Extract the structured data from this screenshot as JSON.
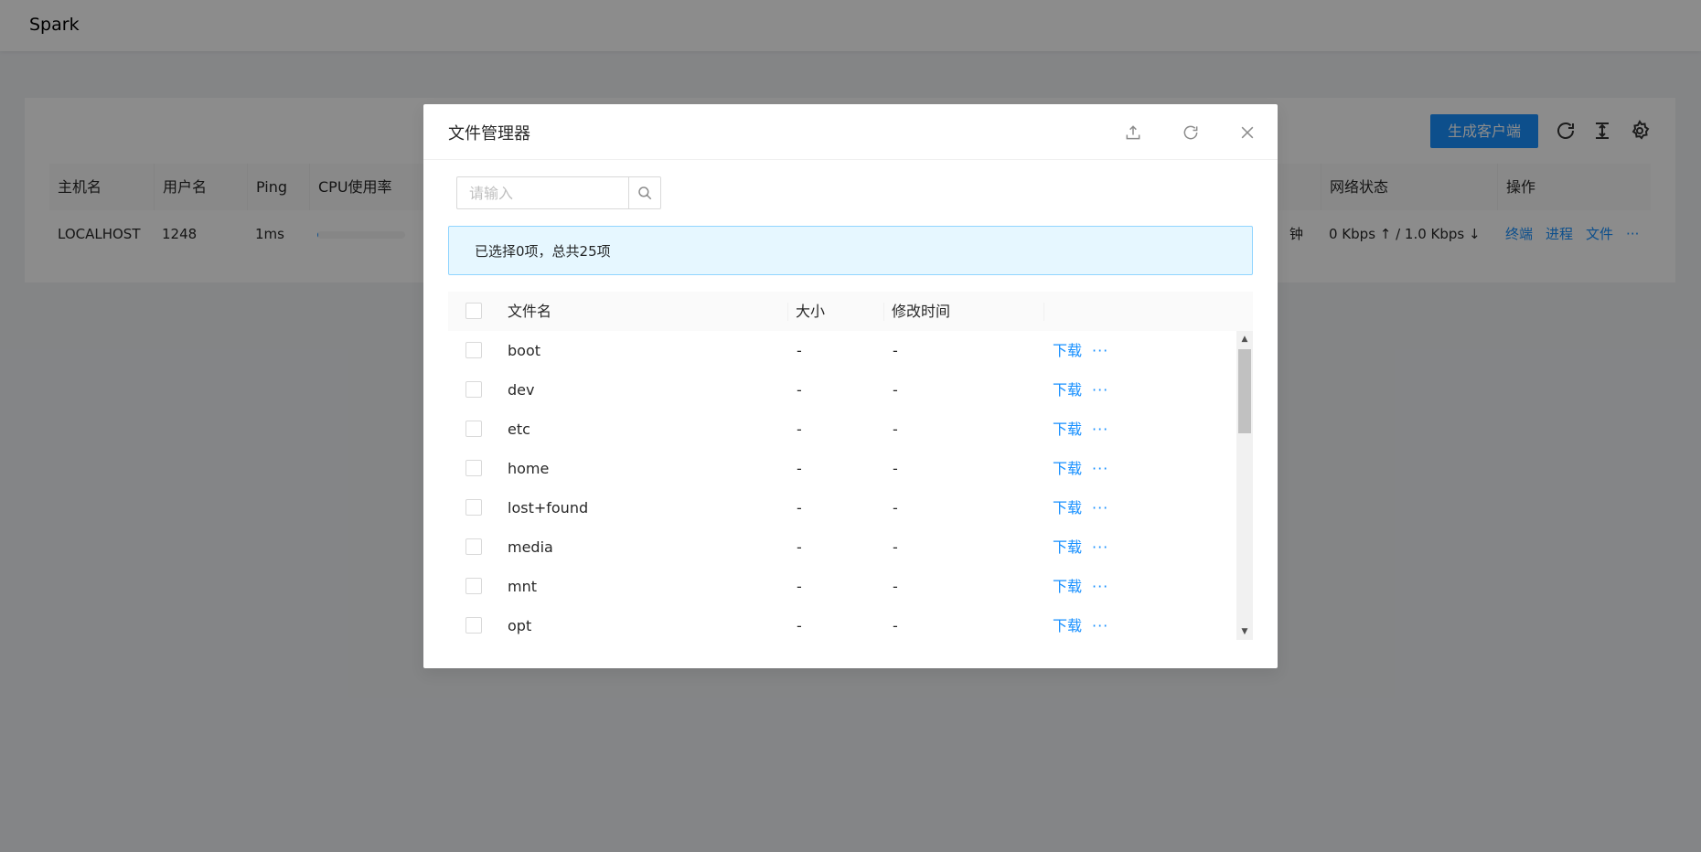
{
  "app": {
    "title": "Spark"
  },
  "toolbar": {
    "generate_client": "生成客户端"
  },
  "bg_table": {
    "headers": {
      "hostname": "主机名",
      "username": "用户名",
      "ping": "Ping",
      "cpu": "CPU使用率",
      "network": "网络状态",
      "actions": "操作"
    },
    "row": {
      "hostname": "LOCALHOST",
      "username": "1248",
      "ping": "1ms",
      "uptime_tail": "钟",
      "network": "0 Kbps ↑ / 1.0 Kbps ↓",
      "actions": [
        "终端",
        "进程",
        "文件"
      ],
      "more": "···"
    },
    "cpu_usage_fraction": 0.01
  },
  "modal": {
    "title": "文件管理器",
    "search": {
      "placeholder": "请输入",
      "value": ""
    },
    "alert": "已选择0项，总共25项",
    "columns": {
      "name": "文件名",
      "size": "大小",
      "mtime": "修改时间"
    },
    "files": [
      {
        "name": "boot",
        "size": "-",
        "mtime": "-",
        "action": "下载",
        "more": "···"
      },
      {
        "name": "dev",
        "size": "-",
        "mtime": "-",
        "action": "下载",
        "more": "···"
      },
      {
        "name": "etc",
        "size": "-",
        "mtime": "-",
        "action": "下载",
        "more": "···"
      },
      {
        "name": "home",
        "size": "-",
        "mtime": "-",
        "action": "下载",
        "more": "···"
      },
      {
        "name": "lost+found",
        "size": "-",
        "mtime": "-",
        "action": "下载",
        "more": "···"
      },
      {
        "name": "media",
        "size": "-",
        "mtime": "-",
        "action": "下载",
        "more": "···"
      },
      {
        "name": "mnt",
        "size": "-",
        "mtime": "-",
        "action": "下载",
        "more": "···"
      },
      {
        "name": "opt",
        "size": "-",
        "mtime": "-",
        "action": "下载",
        "more": "···"
      }
    ]
  },
  "colors": {
    "primary": "#1890ff",
    "alert_bg": "#e6f7ff",
    "alert_border": "#91d5ff"
  },
  "icons": {
    "upload": "upload-icon",
    "reload": "reload-icon",
    "close": "close-icon",
    "search": "search-icon",
    "settings": "gear-icon",
    "column_height": "column-height-icon"
  }
}
